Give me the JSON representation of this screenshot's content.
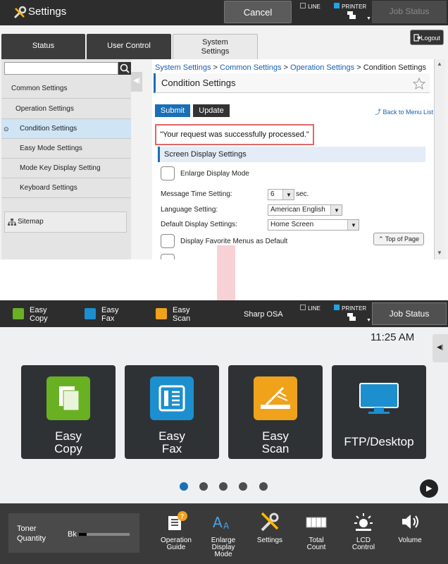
{
  "header": {
    "title": "Settings",
    "cancel_label": "Cancel",
    "line_label": "LINE",
    "printer_label": "PRINTER",
    "job_status_label": "Job Status"
  },
  "web": {
    "tabs": [
      {
        "label": "Status"
      },
      {
        "label": "User Control"
      },
      {
        "label": "System Settings",
        "line1": "System",
        "line2": "Settings"
      }
    ],
    "logout_label": "Logout",
    "nav_items": [
      {
        "label": "Common Settings"
      },
      {
        "label": "Operation Settings"
      },
      {
        "label": "Condition Settings"
      },
      {
        "label": "Easy Mode Settings"
      },
      {
        "label": "Mode Key Display Setting"
      },
      {
        "label": "Keyboard Settings"
      }
    ],
    "sitemap_label": "Sitemap",
    "breadcrumb": {
      "items": [
        "System Settings",
        "Common Settings",
        "Operation Settings"
      ],
      "current": "Condition Settings",
      "sep": ">"
    },
    "page_title": "Condition Settings",
    "submit_label": "Submit",
    "update_label": "Update",
    "back_link": "Back to Menu List",
    "message": "\"Your request was successfully processed.\"",
    "section_title": "Screen Display Settings",
    "enlarge_label": "Enlarge Display Mode",
    "message_time_label": "Message Time Setting:",
    "message_time_value": "6",
    "message_time_unit": "sec.",
    "language_label": "Language Setting:",
    "language_value": "American English",
    "default_display_label": "Default Display Settings:",
    "default_display_value": "Home Screen",
    "favorite_label": "Display Favorite Menus as Default",
    "top_of_page_label": "Top of Page"
  },
  "home": {
    "header_items": [
      {
        "line1": "Easy",
        "line2": "Copy",
        "color": "#6ab023"
      },
      {
        "line1": "Easy",
        "line2": "Fax",
        "color": "#1c8fcf"
      },
      {
        "line1": "Easy",
        "line2": "Scan",
        "color": "#f0a21b"
      }
    ],
    "device_name": "Sharp OSA",
    "line_label": "LINE",
    "printer_label": "PRINTER",
    "job_status_label": "Job Status",
    "clock": "11:25 AM",
    "tiles": [
      {
        "line1": "Easy",
        "line2": "Copy",
        "color": "#6ab023",
        "icon": "copy-icon"
      },
      {
        "line1": "Easy",
        "line2": "Fax",
        "color": "#1c8fcf",
        "icon": "fax-icon"
      },
      {
        "line1": "Easy",
        "line2": "Scan",
        "color": "#f0a21b",
        "icon": "scan-icon"
      },
      {
        "line1": "FTP/Desktop",
        "line2": "",
        "color": "#1c8fcf",
        "icon": "monitor-icon"
      }
    ],
    "active_page": 1,
    "page_count": 5,
    "toner_label_1": "Toner",
    "toner_label_2": "Quantity",
    "toner_color": "Bk",
    "toner_level": 0.15,
    "footer_items": [
      {
        "line1": "Operation",
        "line2": "Guide",
        "line3": ""
      },
      {
        "line1": "Enlarge",
        "line2": "Display",
        "line3": "Mode"
      },
      {
        "line1": "Settings",
        "line2": "",
        "line3": ""
      },
      {
        "line1": "Total",
        "line2": "Count",
        "line3": ""
      },
      {
        "line1": "LCD",
        "line2": "Control",
        "line3": ""
      },
      {
        "line1": "Volume",
        "line2": "",
        "line3": ""
      }
    ]
  }
}
